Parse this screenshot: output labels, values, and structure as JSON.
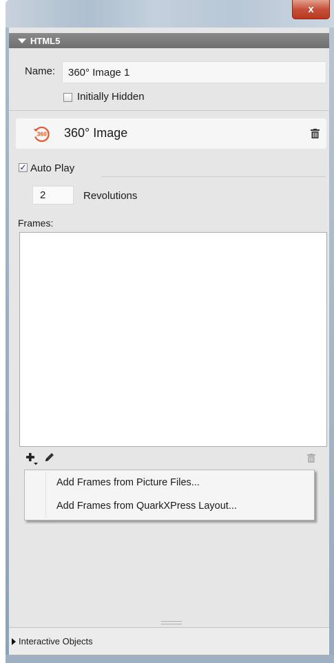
{
  "window": {
    "close_label": "x"
  },
  "section": {
    "title": "HTML5"
  },
  "name_field": {
    "label": "Name:",
    "value": "360° Image 1"
  },
  "initially_hidden": {
    "label": "Initially Hidden",
    "checked": false
  },
  "object": {
    "icon_text": "360",
    "title": "360° Image"
  },
  "auto_play": {
    "label": "Auto Play",
    "checked": true,
    "check_glyph": "✓"
  },
  "revolutions": {
    "value": "2",
    "label": "Revolutions"
  },
  "frames": {
    "label": "Frames:",
    "items": []
  },
  "frames_toolbar": {
    "add_icon": "plus-dropdown-icon",
    "edit_icon": "pencil-icon",
    "delete_icon": "trash-icon"
  },
  "add_menu": {
    "items": [
      {
        "label": "Add Frames from Picture Files..."
      },
      {
        "label": "Add Frames from QuarkXPress Layout..."
      }
    ]
  },
  "footer": {
    "label": "Interactive Objects"
  },
  "colors": {
    "accent_360": "#e0572a",
    "header_bg": "#7a7a7a",
    "panel_bg": "#e6e6e6"
  }
}
